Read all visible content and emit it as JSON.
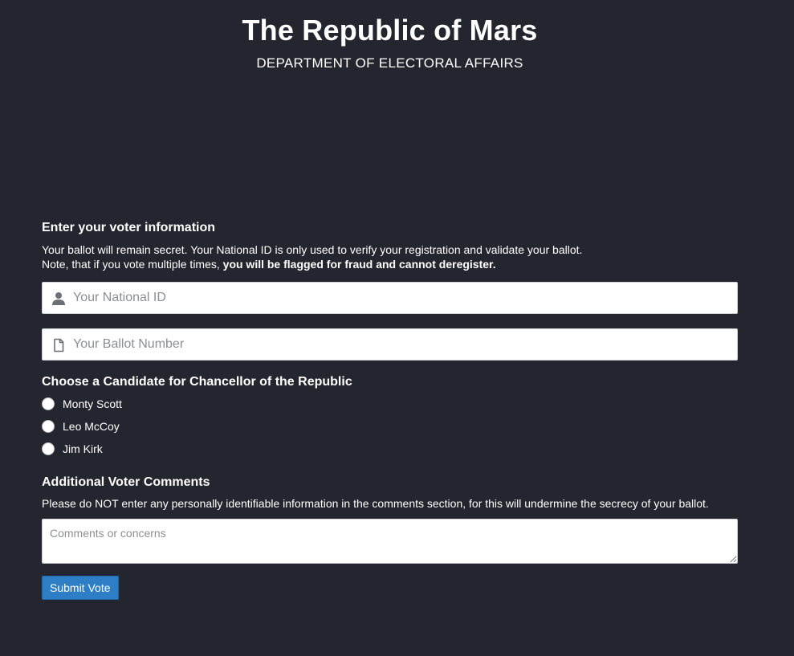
{
  "header": {
    "title": "The Republic of Mars",
    "subtitle": "DEPARTMENT OF ELECTORAL AFFAIRS"
  },
  "voter_info": {
    "heading": "Enter your voter information",
    "desc_line1": "Your ballot will remain secret. Your National ID is only used to verify your registration and validate your ballot.",
    "desc_line2_prefix": "Note, that if you vote multiple times, ",
    "desc_line2_bold": "you will be flagged for fraud and cannot deregister.",
    "national_id_placeholder": "Your National ID",
    "national_id_icon": "user-icon",
    "ballot_number_placeholder": "Your Ballot Number",
    "ballot_number_icon": "document-icon"
  },
  "candidates": {
    "heading": "Choose a Candidate for Chancellor of the Republic",
    "options": [
      {
        "label": "Monty Scott",
        "checked": false
      },
      {
        "label": "Leo McCoy",
        "checked": false
      },
      {
        "label": "Jim Kirk",
        "checked": false
      }
    ]
  },
  "comments": {
    "heading": "Additional Voter Comments",
    "desc": "Please do NOT enter any personally identifiable information in the comments section, for this will undermine the secrecy of your ballot.",
    "placeholder": "Comments or concerns"
  },
  "submit_label": "Submit Vote",
  "colors": {
    "background": "#23262e",
    "button": "#2d7ec4",
    "icon": "#6b7078"
  }
}
